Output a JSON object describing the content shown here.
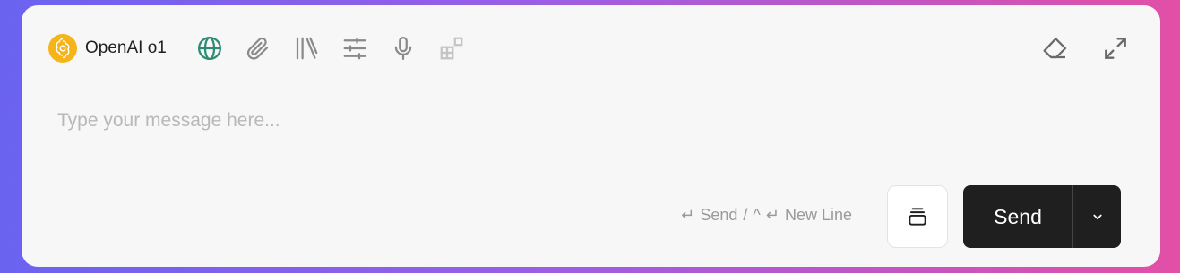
{
  "toolbar": {
    "model_name": "OpenAI o1",
    "model_icon": "openai-logo-icon",
    "tools": [
      {
        "name": "web-search-icon",
        "color": "#2e8b73"
      },
      {
        "name": "attachment-icon",
        "color": "#8a8a8a"
      },
      {
        "name": "knowledge-library-icon",
        "color": "#8a8a8a"
      },
      {
        "name": "settings-sliders-icon",
        "color": "#8a8a8a"
      },
      {
        "name": "microphone-icon",
        "color": "#8a8a8a"
      },
      {
        "name": "apps-grid-icon",
        "color": "#c4c4c4"
      }
    ],
    "right_tools": [
      "eraser-icon",
      "expand-icon"
    ]
  },
  "input": {
    "placeholder": "Type your message here...",
    "value": ""
  },
  "hint": {
    "send": "Send",
    "separator": "/",
    "newline": "New Line"
  },
  "actions": {
    "send_label": "Send"
  },
  "colors": {
    "accent_dark": "#1f1f1f",
    "model_logo_bg": "#f4b41a",
    "globe": "#2e8b73"
  }
}
